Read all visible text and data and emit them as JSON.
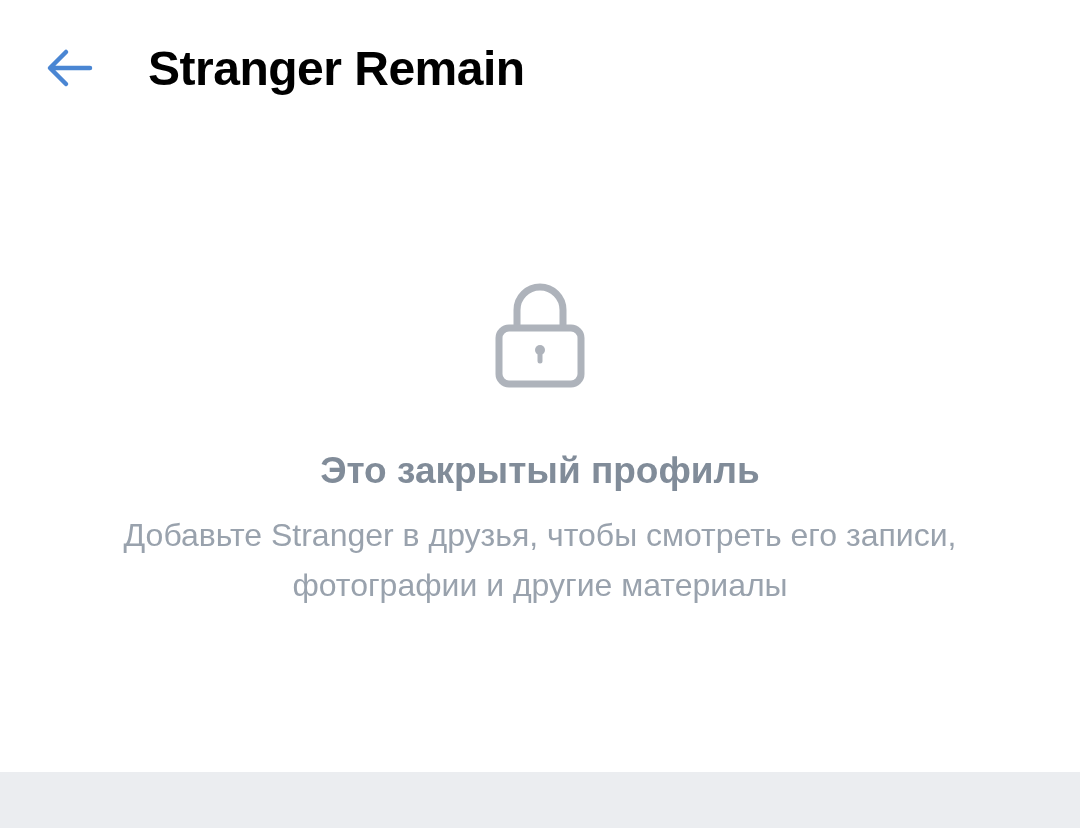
{
  "header": {
    "title": "Stranger Remain"
  },
  "placeholder": {
    "title": "Это закрытый профиль",
    "text": "Добавьте Stranger в друзья, чтобы смотреть его записи, фотографии и другие материалы"
  }
}
